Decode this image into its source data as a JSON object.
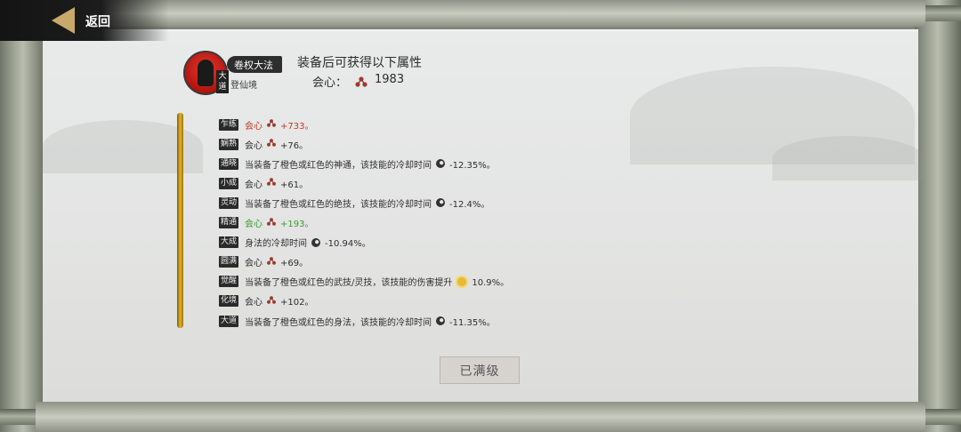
{
  "nav": {
    "back_label": "返回"
  },
  "skill": {
    "name": "卷权大法",
    "avatar_tag": "大道",
    "realm": "登仙境"
  },
  "header": {
    "title": "装备后可获得以下属性",
    "stat_label": "会心：",
    "stat_icon": "trident-icon",
    "stat_value": "1983"
  },
  "levels": [
    {
      "badge": "乍练",
      "pre": "会心",
      "icon": "trident-icon",
      "post": "+733。",
      "color": "#c13a26"
    },
    {
      "badge": "娴熟",
      "pre": "会心",
      "icon": "trident-icon",
      "post": "+76。",
      "color": "#2e2e2e"
    },
    {
      "badge": "通晓",
      "pre": "当装备了橙色或红色的神通，该技能的冷却时间",
      "icon": "moon-icon",
      "post": "-12.35%。",
      "color": "#2e2e2e"
    },
    {
      "badge": "小成",
      "pre": "会心",
      "icon": "trident-icon",
      "post": "+61。",
      "color": "#2e2e2e"
    },
    {
      "badge": "灵动",
      "pre": "当装备了橙色或红色的绝技，该技能的冷却时间",
      "icon": "moon-icon",
      "post": "-12.4%。",
      "color": "#2e2e2e"
    },
    {
      "badge": "精通",
      "pre": "会心",
      "icon": "trident-icon",
      "post": "+193。",
      "color": "#3c9a2c"
    },
    {
      "badge": "大成",
      "pre": "身法的冷却时间",
      "icon": "moon-icon",
      "post": "-10.94%。",
      "color": "#2e2e2e"
    },
    {
      "badge": "圆满",
      "pre": "会心",
      "icon": "trident-icon",
      "post": "+69。",
      "color": "#2e2e2e"
    },
    {
      "badge": "觉醒",
      "pre": "当装备了橙色或红色的武技/灵技，该技能的伤害提升",
      "icon": "sun-icon",
      "post": "10.9%。",
      "color": "#2e2e2e"
    },
    {
      "badge": "化境",
      "pre": "会心",
      "icon": "trident-icon",
      "post": "+102。",
      "color": "#2e2e2e"
    },
    {
      "badge": "大道",
      "pre": "当装备了橙色或红色的身法，该技能的冷却时间",
      "icon": "moon-icon",
      "post": "-11.35%。",
      "color": "#2e2e2e"
    }
  ],
  "footer": {
    "max_label": "已满级"
  }
}
